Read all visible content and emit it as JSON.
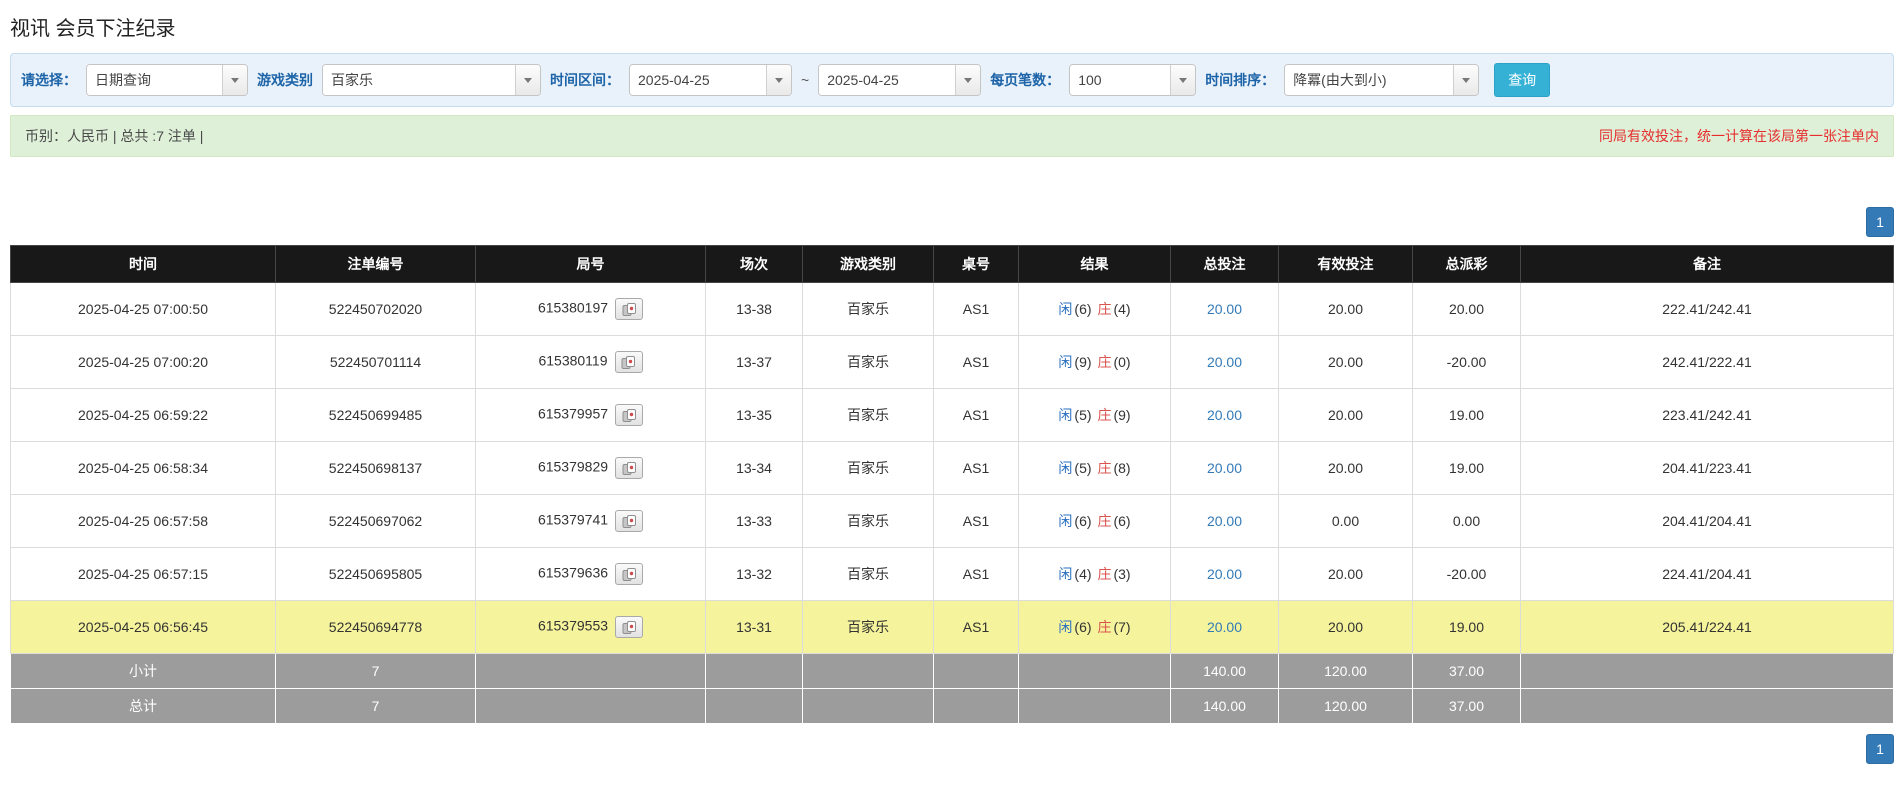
{
  "page": {
    "title": "视讯 会员下注纪录"
  },
  "filters": {
    "select_label": "请选择：",
    "select_value": "日期查询",
    "game_type_label": "游戏类别",
    "game_type_value": "百家乐",
    "date_range_label": "时间区间：",
    "date_from": "2025-04-25",
    "date_separator": "~",
    "date_to": "2025-04-25",
    "page_size_label": "每页笔数：",
    "page_size_value": "100",
    "sort_label": "时间排序：",
    "sort_value": "降冪(由大到小)",
    "search_button": "查询"
  },
  "summary": {
    "left_text": "币别：人民币 | 总共 :7 注单 |",
    "right_note": "同局有效投注，统一计算在该局第一张注单内"
  },
  "pagination": {
    "current_page": "1"
  },
  "table": {
    "headers": [
      "时间",
      "注单编号",
      "局号",
      "场次",
      "游戏类别",
      "桌号",
      "结果",
      "总投注",
      "有效投注",
      "总派彩",
      "备注"
    ],
    "rows": [
      {
        "time": "2025-04-25 07:00:50",
        "bet_id": "522450702020",
        "round_id": "615380197",
        "session": "13-38",
        "game": "百家乐",
        "table_no": "AS1",
        "player_label": "闲",
        "player_num": "(6)",
        "banker_label": "庄",
        "banker_num": "(4)",
        "total_bet": "20.00",
        "valid_bet": "20.00",
        "payout": "20.00",
        "remark": "222.41/242.41",
        "highlight": false
      },
      {
        "time": "2025-04-25 07:00:20",
        "bet_id": "522450701114",
        "round_id": "615380119",
        "session": "13-37",
        "game": "百家乐",
        "table_no": "AS1",
        "player_label": "闲",
        "player_num": "(9)",
        "banker_label": "庄",
        "banker_num": "(0)",
        "total_bet": "20.00",
        "valid_bet": "20.00",
        "payout": "-20.00",
        "remark": "242.41/222.41",
        "highlight": false
      },
      {
        "time": "2025-04-25 06:59:22",
        "bet_id": "522450699485",
        "round_id": "615379957",
        "session": "13-35",
        "game": "百家乐",
        "table_no": "AS1",
        "player_label": "闲",
        "player_num": "(5)",
        "banker_label": "庄",
        "banker_num": "(9)",
        "total_bet": "20.00",
        "valid_bet": "20.00",
        "payout": "19.00",
        "remark": "223.41/242.41",
        "highlight": false
      },
      {
        "time": "2025-04-25 06:58:34",
        "bet_id": "522450698137",
        "round_id": "615379829",
        "session": "13-34",
        "game": "百家乐",
        "table_no": "AS1",
        "player_label": "闲",
        "player_num": "(5)",
        "banker_label": "庄",
        "banker_num": "(8)",
        "total_bet": "20.00",
        "valid_bet": "20.00",
        "payout": "19.00",
        "remark": "204.41/223.41",
        "highlight": false
      },
      {
        "time": "2025-04-25 06:57:58",
        "bet_id": "522450697062",
        "round_id": "615379741",
        "session": "13-33",
        "game": "百家乐",
        "table_no": "AS1",
        "player_label": "闲",
        "player_num": "(6)",
        "banker_label": "庄",
        "banker_num": "(6)",
        "total_bet": "20.00",
        "valid_bet": "0.00",
        "payout": "0.00",
        "remark": "204.41/204.41",
        "highlight": false
      },
      {
        "time": "2025-04-25 06:57:15",
        "bet_id": "522450695805",
        "round_id": "615379636",
        "session": "13-32",
        "game": "百家乐",
        "table_no": "AS1",
        "player_label": "闲",
        "player_num": "(4)",
        "banker_label": "庄",
        "banker_num": "(3)",
        "total_bet": "20.00",
        "valid_bet": "20.00",
        "payout": "-20.00",
        "remark": "224.41/204.41",
        "highlight": false
      },
      {
        "time": "2025-04-25 06:56:45",
        "bet_id": "522450694778",
        "round_id": "615379553",
        "session": "13-31",
        "game": "百家乐",
        "table_no": "AS1",
        "player_label": "闲",
        "player_num": "(6)",
        "banker_label": "庄",
        "banker_num": "(7)",
        "total_bet": "20.00",
        "valid_bet": "20.00",
        "payout": "19.00",
        "remark": "205.41/224.41",
        "highlight": true
      }
    ],
    "subtotal": {
      "label": "小计",
      "count": "7",
      "total_bet": "140.00",
      "valid_bet": "120.00",
      "payout": "37.00"
    },
    "grand_total": {
      "label": "总计",
      "count": "7",
      "total_bet": "140.00",
      "valid_bet": "120.00",
      "payout": "37.00"
    }
  },
  "colors": {
    "accent_blue": "#337ab7",
    "search_button": "#35b1d6",
    "highlight_row": "#f5f39b",
    "negative": "#e03a3a",
    "player_blue": "#2a6fc0",
    "banker_red": "#d9534f"
  }
}
